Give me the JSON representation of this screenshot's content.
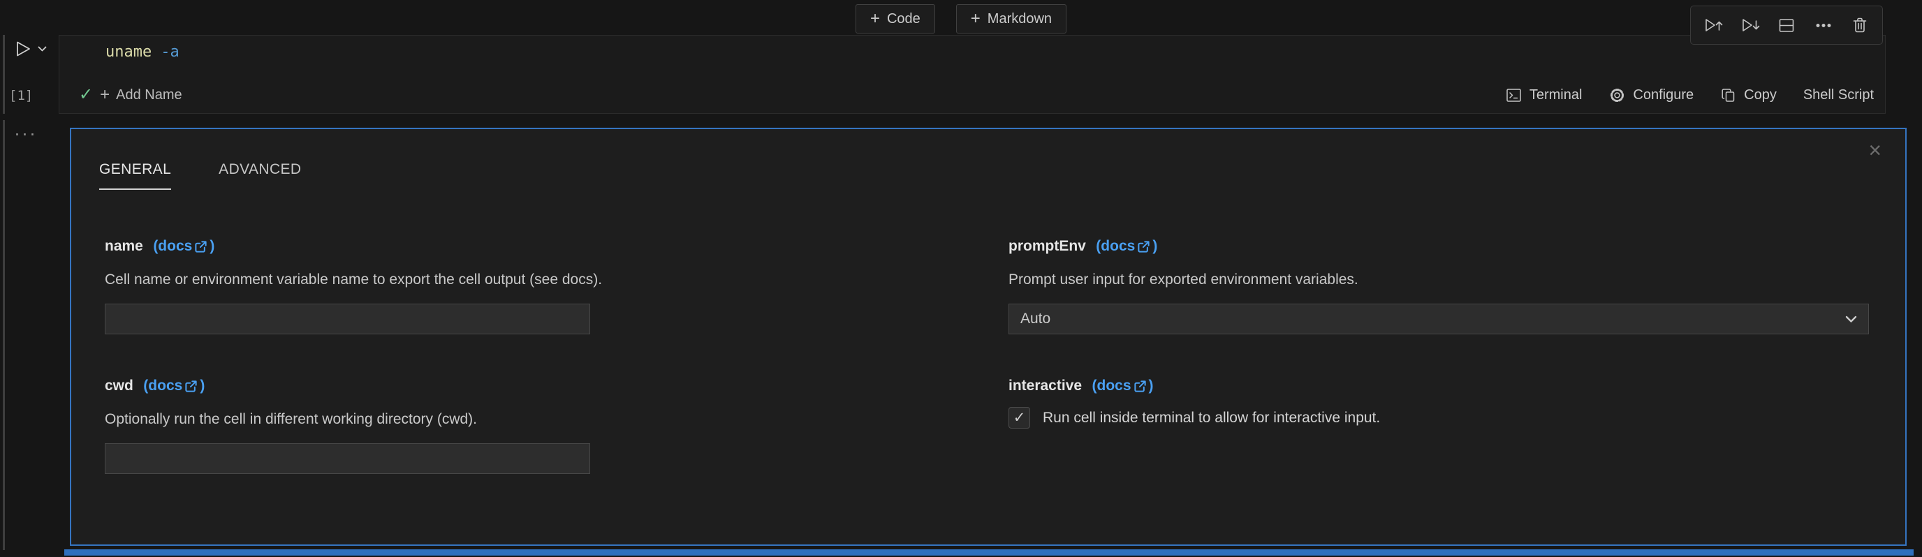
{
  "icons": {
    "plus": "+",
    "check": "✓",
    "close": "×",
    "ellipsis": "···"
  },
  "toolbar": {
    "code_label": "Code",
    "markdown_label": "Markdown"
  },
  "cell": {
    "execution_count": "[1]",
    "code": {
      "command": "uname",
      "flag": "-a"
    },
    "status_bar": {
      "add_name_label": "Add Name",
      "terminal_label": "Terminal",
      "configure_label": "Configure",
      "copy_label": "Copy",
      "language_label": "Shell Script"
    }
  },
  "config_panel": {
    "active_tab": "GENERAL",
    "tabs": [
      {
        "label": "GENERAL"
      },
      {
        "label": "ADVANCED"
      }
    ],
    "fields": {
      "name": {
        "label": "name",
        "docs_open": "(docs",
        "docs_close": ")",
        "description": "Cell name or environment variable name to export the cell output (see docs).",
        "value": ""
      },
      "prompt_env": {
        "label": "promptEnv",
        "docs_open": "(docs",
        "docs_close": ")",
        "description": "Prompt user input for exported environment variables.",
        "selected_option": "Auto"
      },
      "cwd": {
        "label": "cwd",
        "docs_open": "(docs",
        "docs_close": ")",
        "description": "Optionally run the cell in different working directory (cwd).",
        "value": ""
      },
      "interactive": {
        "label": "interactive",
        "docs_open": "(docs",
        "docs_close": ")",
        "checkbox_label": "Run cell inside terminal to allow for interactive input.",
        "checked": true
      }
    }
  },
  "colors": {
    "focus_border": "#3574c0",
    "link": "#4aa0f2",
    "success_green": "#73c991",
    "code_command": "#dcdcaa",
    "code_flag": "#569cd6"
  }
}
